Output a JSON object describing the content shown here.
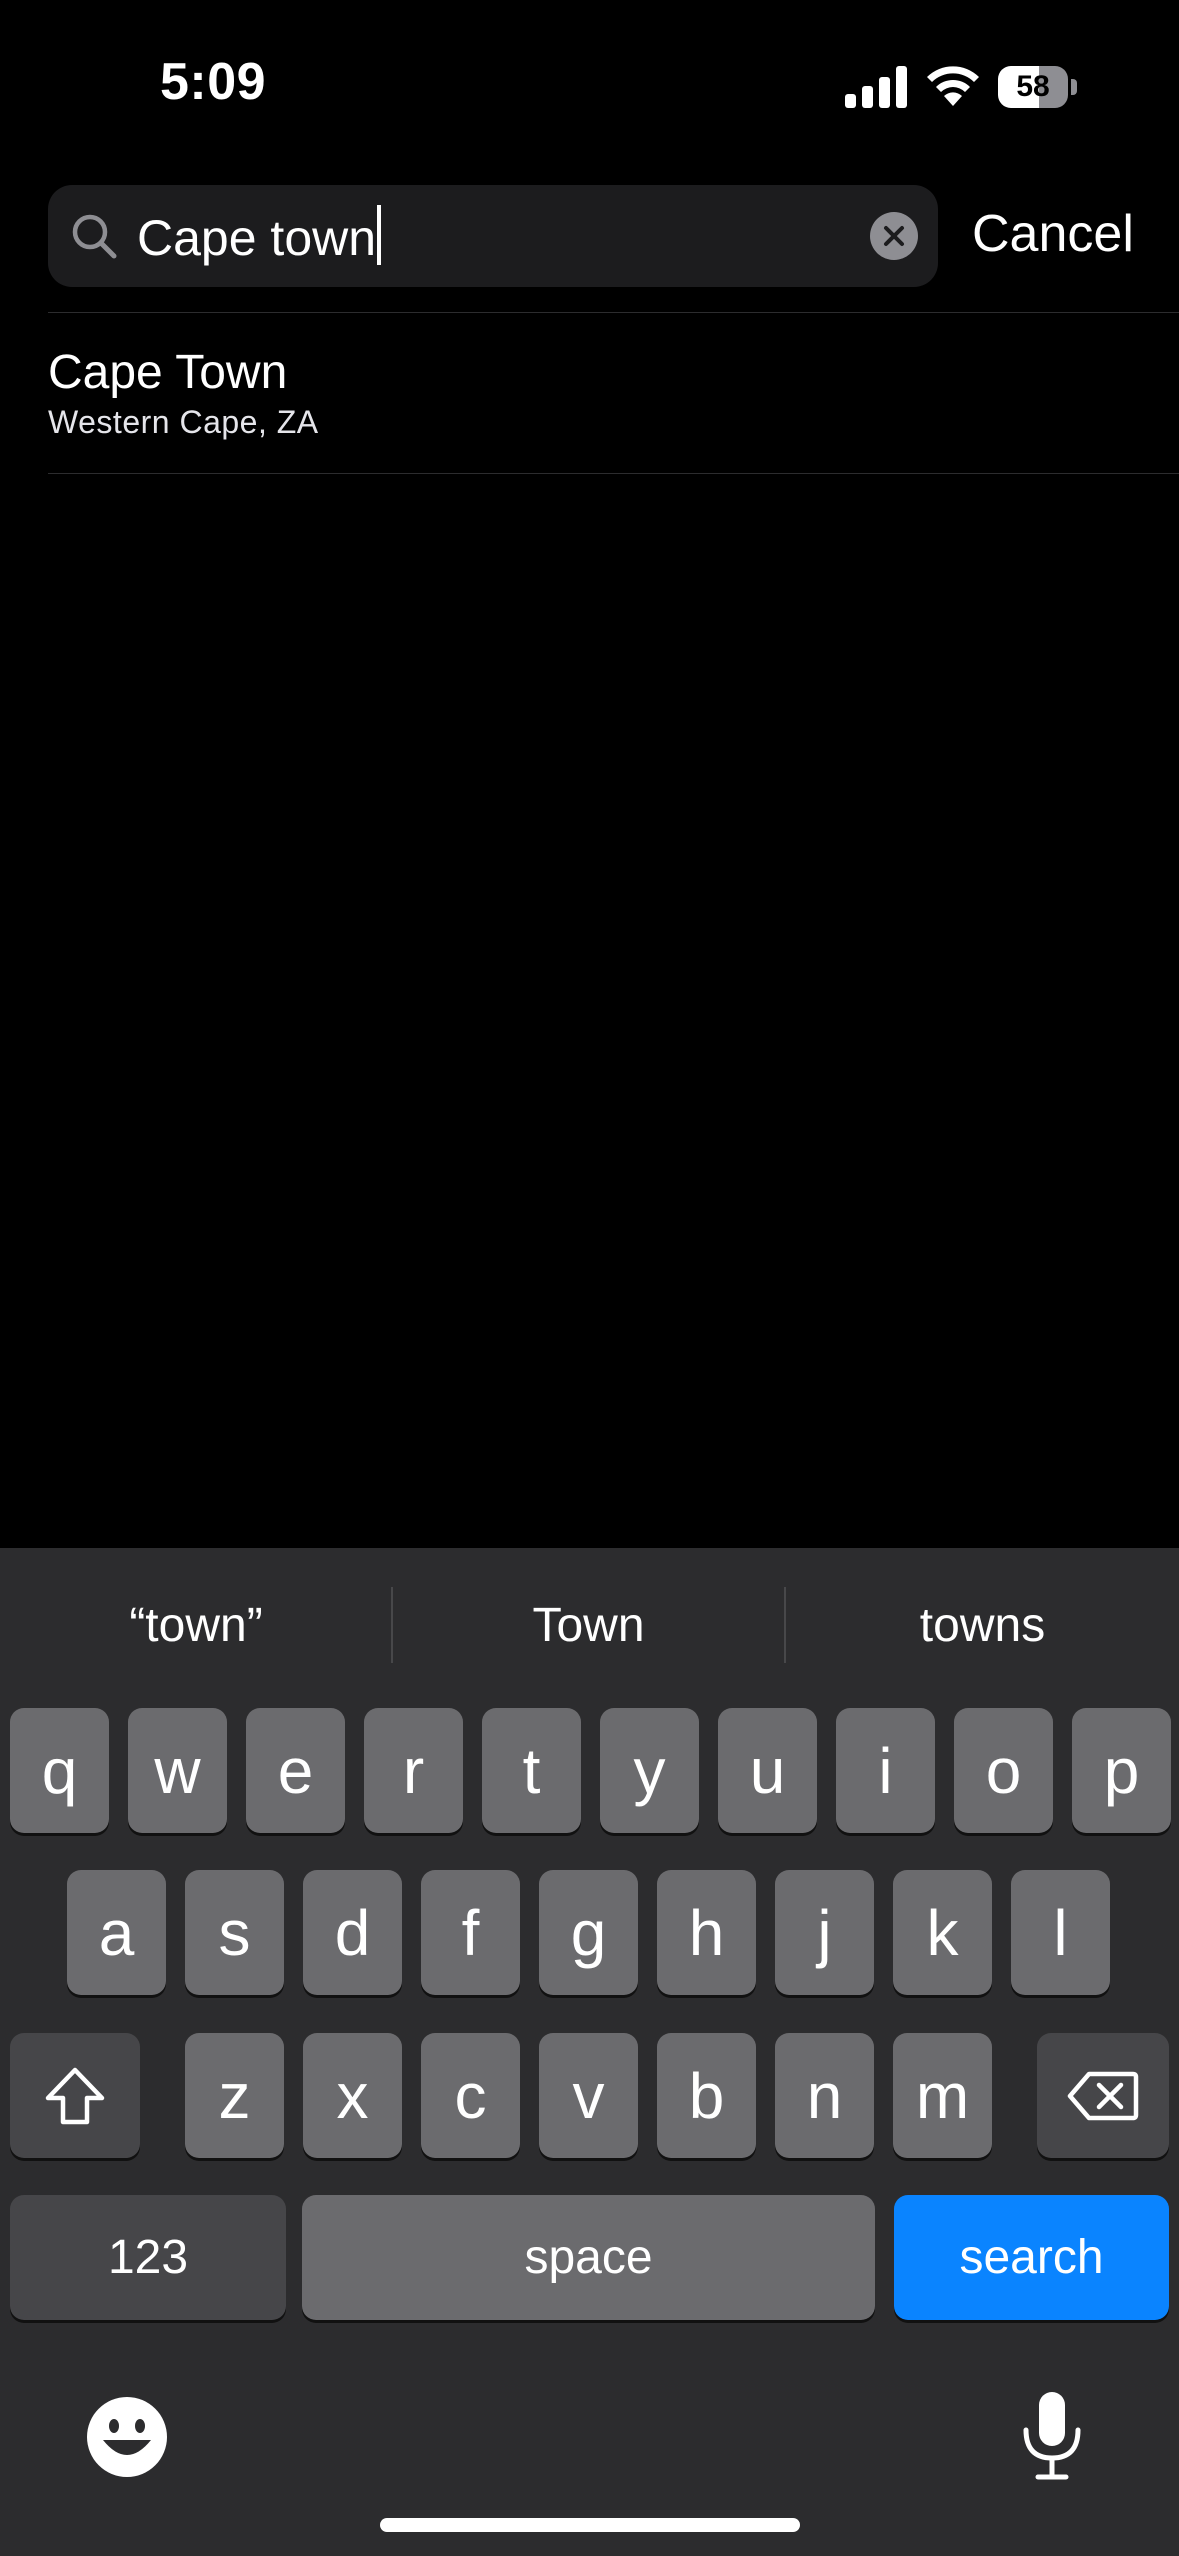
{
  "status_bar": {
    "time": "5:09",
    "battery_level": "58",
    "battery_fraction": 0.58
  },
  "search": {
    "query": "Cape town",
    "cancel_label": "Cancel",
    "icon": "magnifying-glass-icon",
    "clear_icon": "xmark-circle-icon"
  },
  "results": [
    {
      "title": "Cape Town",
      "subtitle": "Western Cape, ZA"
    }
  ],
  "keyboard": {
    "predictions": [
      "“town”",
      "Town",
      "towns"
    ],
    "row1": [
      "q",
      "w",
      "e",
      "r",
      "t",
      "y",
      "u",
      "i",
      "o",
      "p"
    ],
    "row2": [
      "a",
      "s",
      "d",
      "f",
      "g",
      "h",
      "j",
      "k",
      "l"
    ],
    "row3": [
      "z",
      "x",
      "c",
      "v",
      "b",
      "n",
      "m"
    ],
    "numbers_label": "123",
    "space_label": "space",
    "search_label": "search",
    "shift_icon": "shift-arrow-icon",
    "delete_icon": "delete-backspace-icon",
    "emoji_icon": "smiley-face-icon",
    "mic_icon": "microphone-icon",
    "accent_color": "#0a84ff"
  }
}
